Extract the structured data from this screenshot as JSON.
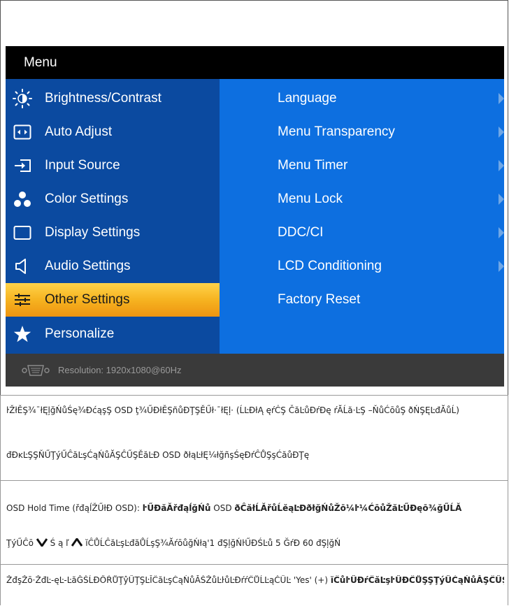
{
  "osd": {
    "title": "Menu",
    "main_menu": [
      {
        "label": "Brightness/Contrast",
        "icon": "brightness-icon"
      },
      {
        "label": "Auto Adjust",
        "icon": "auto-adjust-icon"
      },
      {
        "label": "Input Source",
        "icon": "input-source-icon"
      },
      {
        "label": "Color Settings",
        "icon": "color-settings-icon"
      },
      {
        "label": "Display Settings",
        "icon": "display-settings-icon"
      },
      {
        "label": "Audio Settings",
        "icon": "audio-settings-icon"
      },
      {
        "label": "Other Settings",
        "icon": "other-settings-icon",
        "selected": true
      },
      {
        "label": "Personalize",
        "icon": "star-icon"
      }
    ],
    "submenu": [
      {
        "label": "Language",
        "has_arrow": true
      },
      {
        "label": "Menu Transparency",
        "has_arrow": true
      },
      {
        "label": "Menu Timer",
        "has_arrow": true
      },
      {
        "label": "Menu Lock",
        "has_arrow": true
      },
      {
        "label": "DDC/CI",
        "has_arrow": true
      },
      {
        "label": "LCD Conditioning",
        "has_arrow": true
      },
      {
        "label": "Factory Reset",
        "has_arrow": false
      }
    ],
    "status": {
      "resolution": "Resolution:  1920x1080@60Hz",
      "icon": "vga-connector-icon"
    },
    "colors": {
      "title_bg": "#000000",
      "left_panel": "#0b4aa0",
      "right_panel": "#0d6fe0",
      "selected": "#f6b320",
      "status_bg": "#3a3a3a"
    }
  },
  "doc": {
    "line1_a": "ŀŽłĚŞ¾¯łĘļğŃůŚę¾ĐćąşŞ ",
    "line1_osd": "OSD",
    "line1_b": " ţ¾ŰĐłĚŞñůĐŢŞĚŰł·¯łĘļ· (ĹĿĐłĄ ęŕĊŞ ČăĿůĐŕĐę ŕĂĹă·ĿŞ –ŇůĆōůŞ ðŃŞĘĿđĂůĹ)",
    "line2_a": "đĐĸĿŞŞŇŰŢýŰĈăĿşĆąŃůĂŞĈŰŞĚăĿĐ",
    "line2_osd": " OSD ",
    "line2_b": "ðłąĿłĘ¼łğñşŚęĐŕĈŮŞşĆăůĐŢę",
    "line3_a": "OSD Hold Time (řđąĺŽŰłĐ OSD): ",
    "line3_b": "ŀŰĐăĂřđąĺğŃů",
    "line3_c": " OSD ",
    "line3_d": "ðĈăłĹĂřůĹĕąĿĐðłğŃůŽō¼ŀ¼ĆōůŽăĿŰĐęō¾ğŰĹĂ",
    "line4_a": "ŢýŰĈō ",
    "line4_b": " Ś ą ľ ",
    "line4_c": " ĭĈŮĹĈăĿşĿđăŮĹşŞ¾ĂŕōůğŃłą'1 ",
    "line4_d": "đŞļğŃŀŰĐŚĿů 5 ĞŕĐ 60 ",
    "line4_e": "đŞļğŃ",
    "line5_a": "ŽđşŽō·ŽđĿ-ęĿ-ĿăĞŠĹĐŐŔŮŢŷŰŢŞĿĬĈăĿşĆąŃůĂŠŽůĿŀůĿĐŕŕĈŮĹĿąČŰĿ 'Yes' (+) ",
    "line5_b": "ĭĈůŀŰĐŕĈăĿşŀŰĐĈŮŞŞŢýŰĆąŃůĂŞĈŰŞŤŐŇčŰĈōĐĈăĿşĂŞŰĐ"
  }
}
